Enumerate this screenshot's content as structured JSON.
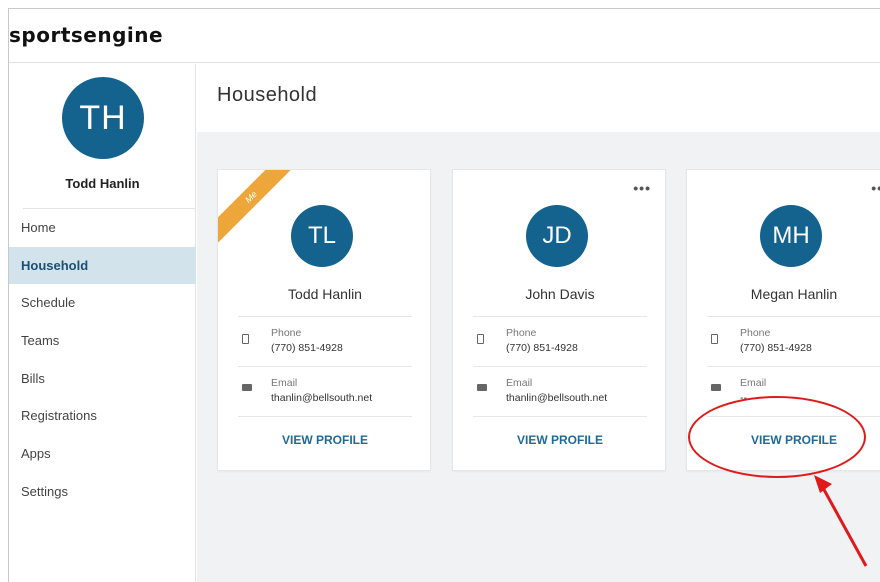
{
  "header": {
    "logo_text": "sportsengine"
  },
  "sidebar": {
    "user_initials": "TH",
    "user_name": "Todd Hanlin",
    "items": [
      {
        "label": "Home",
        "active": false
      },
      {
        "label": "Household",
        "active": true
      },
      {
        "label": "Schedule",
        "active": false
      },
      {
        "label": "Teams",
        "active": false
      },
      {
        "label": "Bills",
        "active": false
      },
      {
        "label": "Registrations",
        "active": false
      },
      {
        "label": "Apps",
        "active": false
      },
      {
        "label": "Settings",
        "active": false
      }
    ]
  },
  "main": {
    "title": "Household",
    "cards": [
      {
        "initials": "TL",
        "name": "Todd Hanlin",
        "badge": "Me",
        "phone_label": "Phone",
        "phone": "(770) 851-4928",
        "email_label": "Email",
        "email": "thanlin@bellsouth.net",
        "action": "VIEW PROFILE"
      },
      {
        "initials": "JD",
        "name": "John Davis",
        "menu": "•••",
        "phone_label": "Phone",
        "phone": "(770) 851-4928",
        "email_label": "Email",
        "email": "thanlin@bellsouth.net",
        "action": "VIEW PROFILE"
      },
      {
        "initials": "MH",
        "name": "Megan Hanlin",
        "menu": "•••",
        "phone_label": "Phone",
        "phone": "(770) 851-4928",
        "email_label": "Email",
        "email": "--",
        "action": "VIEW PROFILE"
      }
    ]
  },
  "colors": {
    "brand_blue": "#14628e",
    "link_blue": "#1e6a98",
    "active_bg": "#d3e3ec",
    "ribbon": "#eda63a",
    "annotation": "#e01a1a"
  },
  "icons": [
    "phone-icon",
    "email-icon",
    "more-options-icon"
  ]
}
